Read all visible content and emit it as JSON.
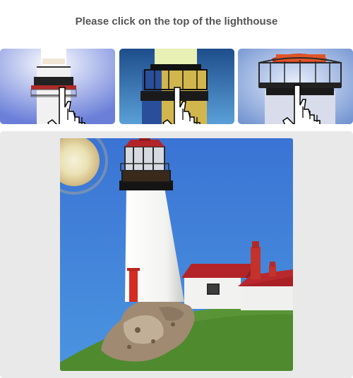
{
  "prompt": {
    "instruction": "Please click on the top of the lighthouse"
  },
  "examples": [
    {
      "name": "example-1",
      "subject": "lighthouse",
      "hint": "pointing-hand-icon"
    },
    {
      "name": "example-2",
      "subject": "lighthouse",
      "hint": "pointing-hand-icon"
    },
    {
      "name": "example-3",
      "subject": "lighthouse",
      "hint": "pointing-hand-icon"
    }
  ],
  "task": {
    "subject": "lighthouse on rocky hill with sun",
    "colors": {
      "sky": "#3d7fd6",
      "grass": "#4f8a2e",
      "tower": "#f4f4f2",
      "roof": "#b3242a",
      "panel": "#e9e9e9"
    }
  }
}
